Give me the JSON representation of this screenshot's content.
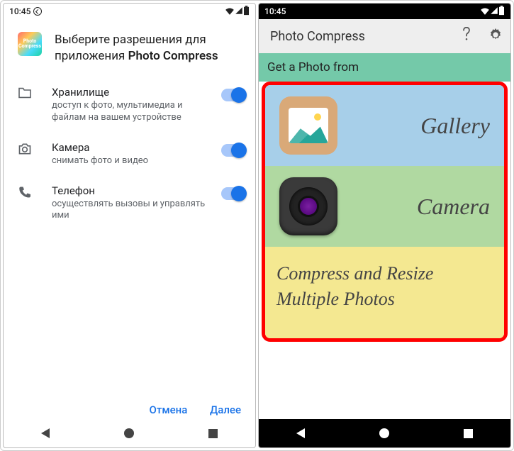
{
  "status": {
    "time": "10:45"
  },
  "left": {
    "title_prefix": "Выберите разрешения для приложения ",
    "title_bold": "Photo Compress",
    "app_icon_text": "Photo\nCompress",
    "permissions": [
      {
        "icon": "folder",
        "title": "Хранилище",
        "desc": "доступ к фото, мультимедиа и файлам на вашем устройстве"
      },
      {
        "icon": "camera",
        "title": "Камера",
        "desc": "снимать фото и видео"
      },
      {
        "icon": "phone",
        "title": "Телефон",
        "desc": "осуществлять вызовы и управлять ими"
      }
    ],
    "actions": {
      "cancel": "Отмена",
      "next": "Далее"
    }
  },
  "right": {
    "app_title": "Photo Compress",
    "get_from": "Get a Photo from",
    "rows": {
      "gallery": "Gallery",
      "camera": "Camera",
      "multi": "Compress and Resize Multiple Photos"
    }
  }
}
